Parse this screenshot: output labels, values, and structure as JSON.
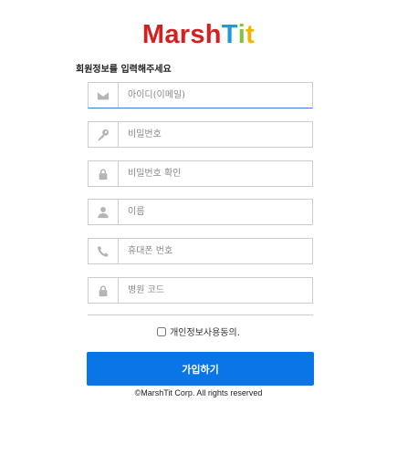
{
  "logo": {
    "parts": [
      {
        "text": "Marsh",
        "color": "#d42020"
      },
      {
        "text": "T",
        "color": "#1f9bd7"
      },
      {
        "text": "i",
        "color": "#7ec440"
      },
      {
        "text": "t",
        "color": "#f2b300"
      }
    ]
  },
  "subtitle": "회원정보를 입력해주세요",
  "fields": [
    {
      "icon": "envelope-icon",
      "placeholder": "아이디(이메일)"
    },
    {
      "icon": "key-icon",
      "placeholder": "비밀번호"
    },
    {
      "icon": "lock-icon",
      "placeholder": "비밀번호 확인"
    },
    {
      "icon": "user-icon",
      "placeholder": "이름"
    },
    {
      "icon": "phone-icon",
      "placeholder": "휴대폰 번호"
    },
    {
      "icon": "lock-icon",
      "placeholder": "병원 코드"
    }
  ],
  "agree_label": "개인정보사용동의.",
  "signup_label": "가입하기",
  "copyright": "©MarshTit Corp. All rights reserved",
  "colors": {
    "accent": "#0a75e6",
    "icon": "#b5b5b5"
  }
}
